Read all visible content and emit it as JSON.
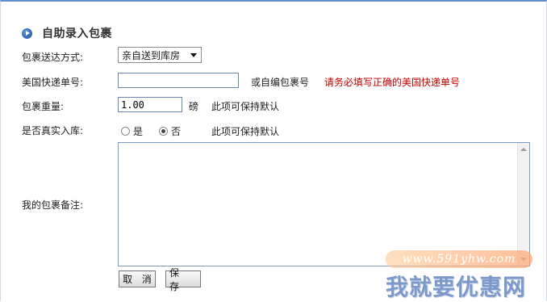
{
  "header": {
    "title": "自助录入包裹",
    "icon": "play-circle-icon"
  },
  "form": {
    "delivery": {
      "label": "包裹送达方式:",
      "selected": "亲自送到库房"
    },
    "tracking": {
      "label": "美国快递单号:",
      "value": "",
      "or_text": "或自编包裹号",
      "warning": "请务必填写正确的美国快递单号"
    },
    "weight": {
      "label": "包裹重量:",
      "value": "1.00",
      "unit": "磅",
      "hint": "此项可保持默认"
    },
    "real_inbound": {
      "label": "是否真实入库:",
      "option_yes": "是",
      "option_no": "否",
      "selected": "否",
      "hint": "此项可保持默认"
    },
    "notes": {
      "label": "我的包裹备注:",
      "value": ""
    }
  },
  "buttons": {
    "cancel": "取 消",
    "save": "保 存"
  },
  "watermark": {
    "url": "www.591yhw.com",
    "logo": "我就要优惠网"
  },
  "colors": {
    "accent": "#5b8fd0",
    "warning": "#c00000",
    "title_icon": "#1d4f9b"
  }
}
